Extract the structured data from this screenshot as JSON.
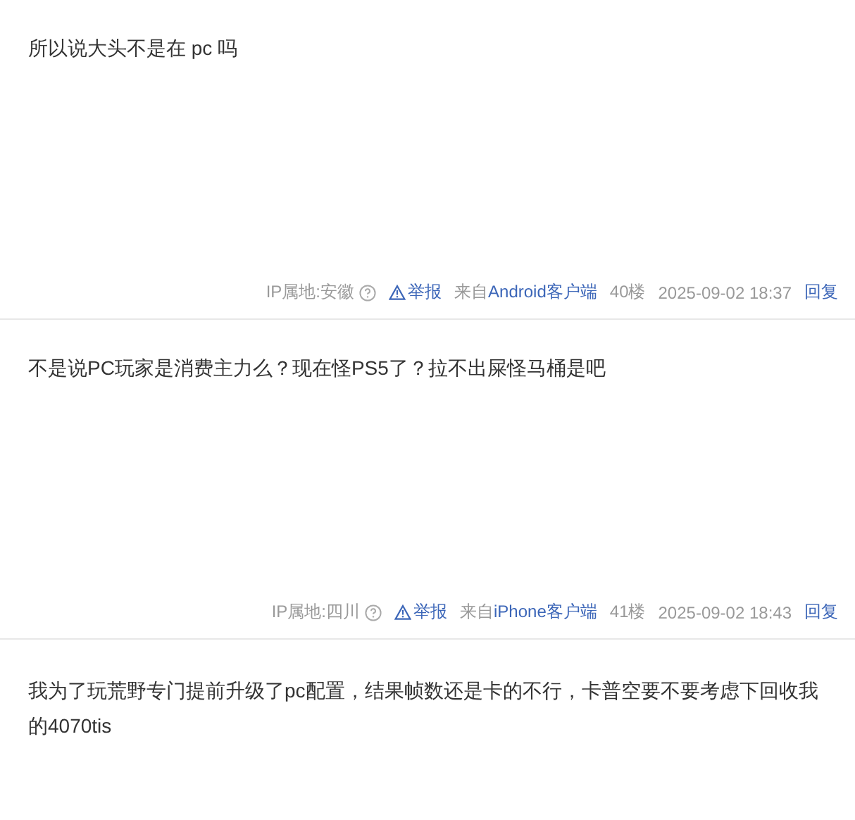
{
  "posts": [
    {
      "content": "所以说大头不是在 pc 吗",
      "meta": {
        "ip": "IP属地:安徽",
        "report": "举报",
        "source_prefix": "来自",
        "source": "Android客户端",
        "floor": "40楼",
        "time": "2025-09-02 18:37",
        "reply": "回复"
      }
    },
    {
      "content": "不是说PC玩家是消费主力么？现在怪PS5了？拉不出屎怪马桶是吧",
      "meta": {
        "ip": "IP属地:四川",
        "report": "举报",
        "source_prefix": "来自",
        "source": "iPhone客户端",
        "floor": "41楼",
        "time": "2025-09-02 18:43",
        "reply": "回复"
      }
    },
    {
      "content": "我为了玩荒野专门提前升级了pc配置，结果帧数还是卡的不行，卡普空要不要考虑下回收我的4070tis"
    }
  ]
}
